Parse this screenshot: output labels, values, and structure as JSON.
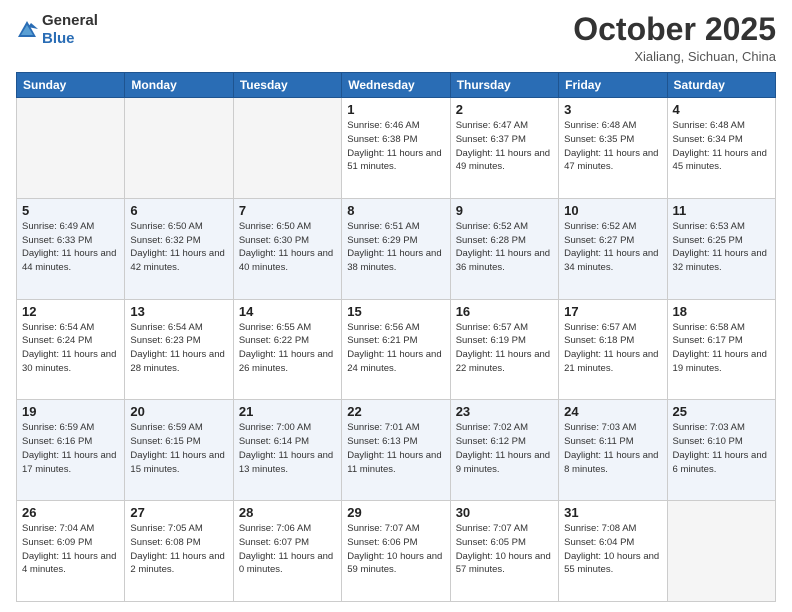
{
  "header": {
    "logo_general": "General",
    "logo_blue": "Blue",
    "title": "October 2025",
    "location": "Xialiang, Sichuan, China"
  },
  "weekdays": [
    "Sunday",
    "Monday",
    "Tuesday",
    "Wednesday",
    "Thursday",
    "Friday",
    "Saturday"
  ],
  "weeks": [
    {
      "shaded": false,
      "days": [
        {
          "num": "",
          "sunrise": "",
          "sunset": "",
          "daylight": "",
          "empty": true
        },
        {
          "num": "",
          "sunrise": "",
          "sunset": "",
          "daylight": "",
          "empty": true
        },
        {
          "num": "",
          "sunrise": "",
          "sunset": "",
          "daylight": "",
          "empty": true
        },
        {
          "num": "1",
          "sunrise": "Sunrise: 6:46 AM",
          "sunset": "Sunset: 6:38 PM",
          "daylight": "Daylight: 11 hours and 51 minutes.",
          "empty": false
        },
        {
          "num": "2",
          "sunrise": "Sunrise: 6:47 AM",
          "sunset": "Sunset: 6:37 PM",
          "daylight": "Daylight: 11 hours and 49 minutes.",
          "empty": false
        },
        {
          "num": "3",
          "sunrise": "Sunrise: 6:48 AM",
          "sunset": "Sunset: 6:35 PM",
          "daylight": "Daylight: 11 hours and 47 minutes.",
          "empty": false
        },
        {
          "num": "4",
          "sunrise": "Sunrise: 6:48 AM",
          "sunset": "Sunset: 6:34 PM",
          "daylight": "Daylight: 11 hours and 45 minutes.",
          "empty": false
        }
      ]
    },
    {
      "shaded": true,
      "days": [
        {
          "num": "5",
          "sunrise": "Sunrise: 6:49 AM",
          "sunset": "Sunset: 6:33 PM",
          "daylight": "Daylight: 11 hours and 44 minutes.",
          "empty": false
        },
        {
          "num": "6",
          "sunrise": "Sunrise: 6:50 AM",
          "sunset": "Sunset: 6:32 PM",
          "daylight": "Daylight: 11 hours and 42 minutes.",
          "empty": false
        },
        {
          "num": "7",
          "sunrise": "Sunrise: 6:50 AM",
          "sunset": "Sunset: 6:30 PM",
          "daylight": "Daylight: 11 hours and 40 minutes.",
          "empty": false
        },
        {
          "num": "8",
          "sunrise": "Sunrise: 6:51 AM",
          "sunset": "Sunset: 6:29 PM",
          "daylight": "Daylight: 11 hours and 38 minutes.",
          "empty": false
        },
        {
          "num": "9",
          "sunrise": "Sunrise: 6:52 AM",
          "sunset": "Sunset: 6:28 PM",
          "daylight": "Daylight: 11 hours and 36 minutes.",
          "empty": false
        },
        {
          "num": "10",
          "sunrise": "Sunrise: 6:52 AM",
          "sunset": "Sunset: 6:27 PM",
          "daylight": "Daylight: 11 hours and 34 minutes.",
          "empty": false
        },
        {
          "num": "11",
          "sunrise": "Sunrise: 6:53 AM",
          "sunset": "Sunset: 6:25 PM",
          "daylight": "Daylight: 11 hours and 32 minutes.",
          "empty": false
        }
      ]
    },
    {
      "shaded": false,
      "days": [
        {
          "num": "12",
          "sunrise": "Sunrise: 6:54 AM",
          "sunset": "Sunset: 6:24 PM",
          "daylight": "Daylight: 11 hours and 30 minutes.",
          "empty": false
        },
        {
          "num": "13",
          "sunrise": "Sunrise: 6:54 AM",
          "sunset": "Sunset: 6:23 PM",
          "daylight": "Daylight: 11 hours and 28 minutes.",
          "empty": false
        },
        {
          "num": "14",
          "sunrise": "Sunrise: 6:55 AM",
          "sunset": "Sunset: 6:22 PM",
          "daylight": "Daylight: 11 hours and 26 minutes.",
          "empty": false
        },
        {
          "num": "15",
          "sunrise": "Sunrise: 6:56 AM",
          "sunset": "Sunset: 6:21 PM",
          "daylight": "Daylight: 11 hours and 24 minutes.",
          "empty": false
        },
        {
          "num": "16",
          "sunrise": "Sunrise: 6:57 AM",
          "sunset": "Sunset: 6:19 PM",
          "daylight": "Daylight: 11 hours and 22 minutes.",
          "empty": false
        },
        {
          "num": "17",
          "sunrise": "Sunrise: 6:57 AM",
          "sunset": "Sunset: 6:18 PM",
          "daylight": "Daylight: 11 hours and 21 minutes.",
          "empty": false
        },
        {
          "num": "18",
          "sunrise": "Sunrise: 6:58 AM",
          "sunset": "Sunset: 6:17 PM",
          "daylight": "Daylight: 11 hours and 19 minutes.",
          "empty": false
        }
      ]
    },
    {
      "shaded": true,
      "days": [
        {
          "num": "19",
          "sunrise": "Sunrise: 6:59 AM",
          "sunset": "Sunset: 6:16 PM",
          "daylight": "Daylight: 11 hours and 17 minutes.",
          "empty": false
        },
        {
          "num": "20",
          "sunrise": "Sunrise: 6:59 AM",
          "sunset": "Sunset: 6:15 PM",
          "daylight": "Daylight: 11 hours and 15 minutes.",
          "empty": false
        },
        {
          "num": "21",
          "sunrise": "Sunrise: 7:00 AM",
          "sunset": "Sunset: 6:14 PM",
          "daylight": "Daylight: 11 hours and 13 minutes.",
          "empty": false
        },
        {
          "num": "22",
          "sunrise": "Sunrise: 7:01 AM",
          "sunset": "Sunset: 6:13 PM",
          "daylight": "Daylight: 11 hours and 11 minutes.",
          "empty": false
        },
        {
          "num": "23",
          "sunrise": "Sunrise: 7:02 AM",
          "sunset": "Sunset: 6:12 PM",
          "daylight": "Daylight: 11 hours and 9 minutes.",
          "empty": false
        },
        {
          "num": "24",
          "sunrise": "Sunrise: 7:03 AM",
          "sunset": "Sunset: 6:11 PM",
          "daylight": "Daylight: 11 hours and 8 minutes.",
          "empty": false
        },
        {
          "num": "25",
          "sunrise": "Sunrise: 7:03 AM",
          "sunset": "Sunset: 6:10 PM",
          "daylight": "Daylight: 11 hours and 6 minutes.",
          "empty": false
        }
      ]
    },
    {
      "shaded": false,
      "days": [
        {
          "num": "26",
          "sunrise": "Sunrise: 7:04 AM",
          "sunset": "Sunset: 6:09 PM",
          "daylight": "Daylight: 11 hours and 4 minutes.",
          "empty": false
        },
        {
          "num": "27",
          "sunrise": "Sunrise: 7:05 AM",
          "sunset": "Sunset: 6:08 PM",
          "daylight": "Daylight: 11 hours and 2 minutes.",
          "empty": false
        },
        {
          "num": "28",
          "sunrise": "Sunrise: 7:06 AM",
          "sunset": "Sunset: 6:07 PM",
          "daylight": "Daylight: 11 hours and 0 minutes.",
          "empty": false
        },
        {
          "num": "29",
          "sunrise": "Sunrise: 7:07 AM",
          "sunset": "Sunset: 6:06 PM",
          "daylight": "Daylight: 10 hours and 59 minutes.",
          "empty": false
        },
        {
          "num": "30",
          "sunrise": "Sunrise: 7:07 AM",
          "sunset": "Sunset: 6:05 PM",
          "daylight": "Daylight: 10 hours and 57 minutes.",
          "empty": false
        },
        {
          "num": "31",
          "sunrise": "Sunrise: 7:08 AM",
          "sunset": "Sunset: 6:04 PM",
          "daylight": "Daylight: 10 hours and 55 minutes.",
          "empty": false
        },
        {
          "num": "",
          "sunrise": "",
          "sunset": "",
          "daylight": "",
          "empty": true
        }
      ]
    }
  ]
}
